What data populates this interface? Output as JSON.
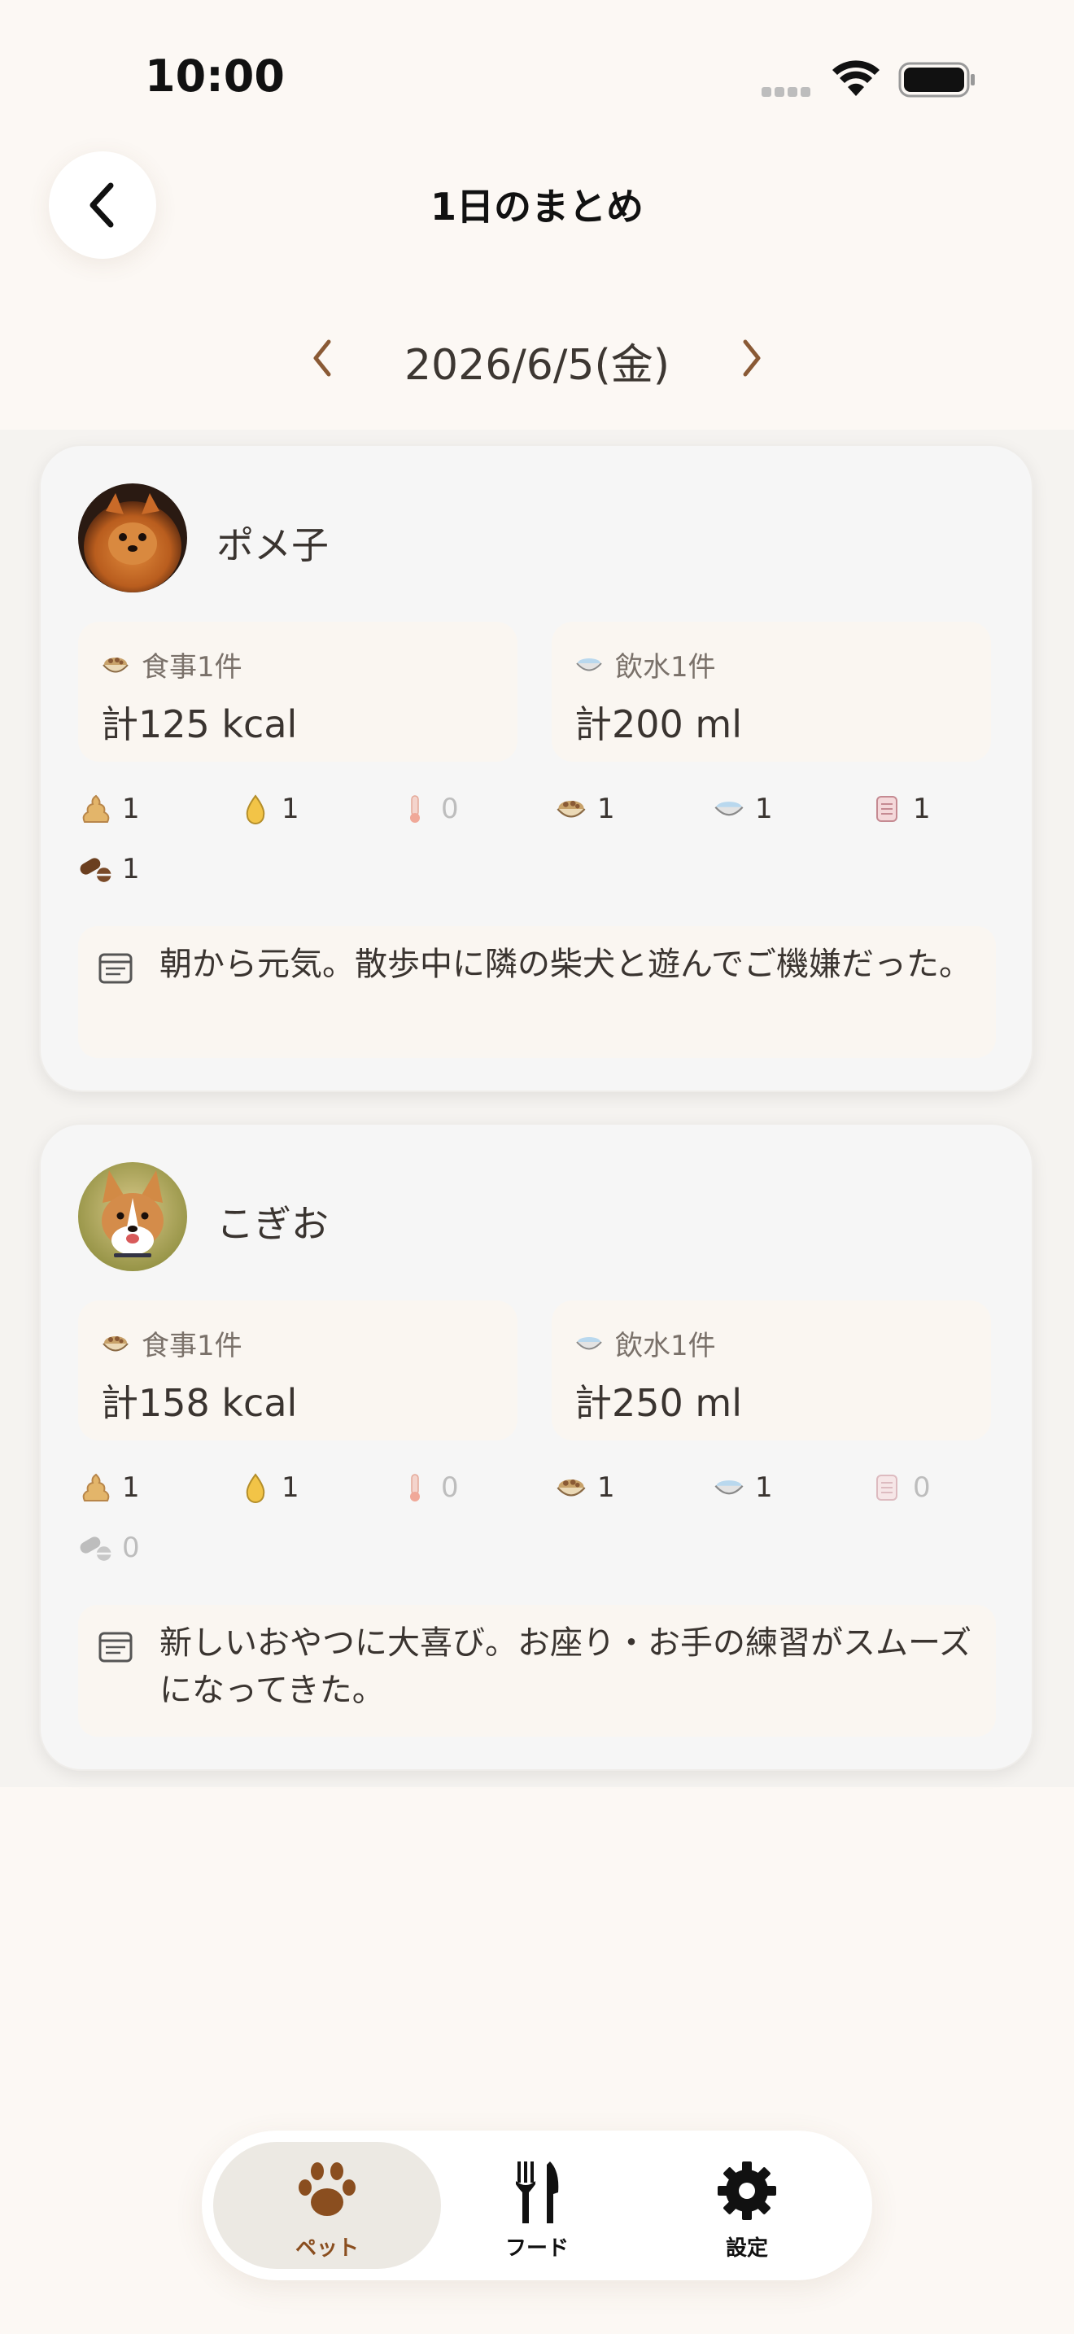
{
  "status_bar": {
    "time": "10:00"
  },
  "header": {
    "title": "1日のまとめ"
  },
  "date_nav": {
    "date": "2026/6/5(金)"
  },
  "pets": [
    {
      "name": "ポメ子",
      "meal_label": "食事1件",
      "meal_value": "計125 kcal",
      "water_label": "飲水1件",
      "water_value": "計200 ml",
      "counts": {
        "poop": "1",
        "pee": "1",
        "temp": "0",
        "food": "1",
        "water": "1",
        "memo": "1",
        "medicine": "1"
      },
      "note": "朝から元気。散歩中に隣の柴犬と遊んでご機嫌だった。"
    },
    {
      "name": "こぎお",
      "meal_label": "食事1件",
      "meal_value": "計158 kcal",
      "water_label": "飲水1件",
      "water_value": "計250 ml",
      "counts": {
        "poop": "1",
        "pee": "1",
        "temp": "0",
        "food": "1",
        "water": "1",
        "memo": "0",
        "medicine": "0"
      },
      "note": "新しいおやつに大喜び。お座り・お手の練習がスムーズになってきた。"
    }
  ],
  "bottom_nav": {
    "items": [
      {
        "label": "ペット",
        "icon": "paw-icon",
        "active": true
      },
      {
        "label": "フード",
        "icon": "fork-knife-icon",
        "active": false
      },
      {
        "label": "設定",
        "icon": "gear-icon",
        "active": false
      }
    ]
  },
  "colors": {
    "background": "#FCF8F4",
    "accent_brown": "#8A4E1F",
    "card": "#F6F6F6"
  }
}
